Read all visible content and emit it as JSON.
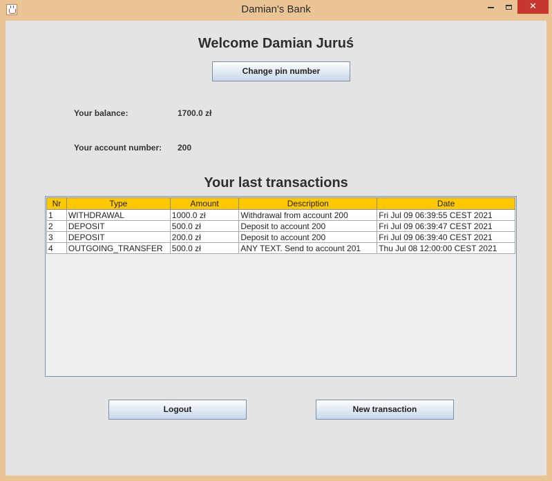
{
  "window": {
    "title": "Damian's Bank",
    "close_glyph": "✕"
  },
  "header": {
    "welcome": "Welcome Damian Juruś",
    "change_pin_label": "Change pin number"
  },
  "account": {
    "balance_label": "Your balance:",
    "balance_value": "1700.0 zł",
    "account_number_label": "Your account number:",
    "account_number_value": "200"
  },
  "transactions": {
    "heading": "Your last transactions",
    "columns": [
      "Nr",
      "Type",
      "Amount",
      "Description",
      "Date"
    ],
    "rows": [
      [
        "1",
        "WITHDRAWAL",
        "1000.0 zł",
        "Withdrawal from account 200",
        "Fri Jul 09 06:39:55 CEST 2021"
      ],
      [
        "2",
        "DEPOSIT",
        "500.0 zł",
        "Deposit to account 200",
        "Fri Jul 09 06:39:47 CEST 2021"
      ],
      [
        "3",
        "DEPOSIT",
        "200.0 zł",
        "Deposit to account 200",
        "Fri Jul 09 06:39:40 CEST 2021"
      ],
      [
        "4",
        "OUTGOING_TRANSFER",
        "500.0 zł",
        "ANY TEXT. Send to account 201",
        "Thu Jul 08 12:00:00 CEST 2021"
      ]
    ],
    "header_color": "#ffc800"
  },
  "footer": {
    "logout_label": "Logout",
    "new_transaction_label": "New transaction"
  },
  "icons": {
    "app": "java-cup-icon",
    "minimize": "minimize-icon",
    "maximize": "maximize-icon",
    "close": "close-icon"
  }
}
